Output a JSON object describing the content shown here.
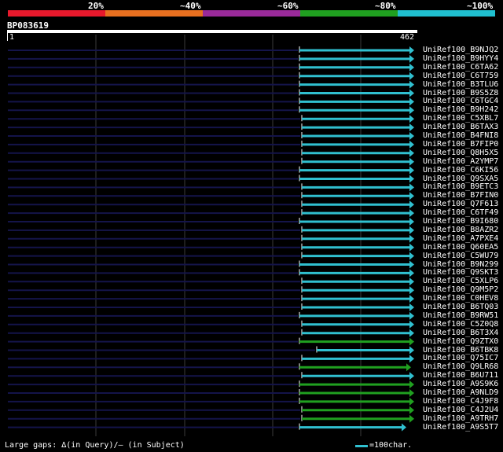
{
  "legend": {
    "segments": [
      {
        "color": "#e8192c"
      },
      {
        "color": "#e87020"
      },
      {
        "color": "#9a2a9a"
      },
      {
        "color": "#20a020"
      },
      {
        "color": "#20c0d0"
      }
    ],
    "labels": [
      "20%",
      "~40%",
      "~60%",
      "~80%",
      "~100%"
    ]
  },
  "query": {
    "id": "BP083619",
    "start": "1",
    "end": "462"
  },
  "colors": {
    "background": "#000000",
    "query_line": "#14144a",
    "grid": "#3a3a3a",
    "hit_cyan": "#30c0d0",
    "hit_green": "#20a020",
    "white": "#ffffff"
  },
  "hits": [
    {
      "label": "UniRef100_B9NJQ2",
      "color": "cyan"
    },
    {
      "label": "UniRef100_B9HYY4",
      "color": "cyan"
    },
    {
      "label": "UniRef100_C6TA62",
      "color": "cyan"
    },
    {
      "label": "UniRef100_C6T759",
      "color": "cyan"
    },
    {
      "label": "UniRef100_B3TLU6",
      "color": "cyan"
    },
    {
      "label": "UniRef100_B9S5Z8",
      "color": "cyan"
    },
    {
      "label": "UniRef100_C6TGC4",
      "color": "cyan"
    },
    {
      "label": "UniRef100_B9H242",
      "color": "cyan"
    },
    {
      "label": "UniRef100_C5XBL7",
      "color": "cyan"
    },
    {
      "label": "UniRef100_B6TAX3",
      "color": "cyan"
    },
    {
      "label": "UniRef100_B4FNI8",
      "color": "cyan"
    },
    {
      "label": "UniRef100_B7FIP0",
      "color": "cyan"
    },
    {
      "label": "UniRef100_Q8H5X5",
      "color": "cyan"
    },
    {
      "label": "UniRef100_A2YMP7",
      "color": "cyan"
    },
    {
      "label": "UniRef100_C6KI56",
      "color": "cyan"
    },
    {
      "label": "UniRef100_Q9SXA5",
      "color": "cyan"
    },
    {
      "label": "UniRef100_B9ETC3",
      "color": "cyan"
    },
    {
      "label": "UniRef100_B7FIN0",
      "color": "cyan"
    },
    {
      "label": "UniRef100_Q7F613",
      "color": "cyan"
    },
    {
      "label": "UniRef100_C6TF49",
      "color": "cyan"
    },
    {
      "label": "UniRef100_B9I680",
      "color": "cyan"
    },
    {
      "label": "UniRef100_B8AZR2",
      "color": "cyan"
    },
    {
      "label": "UniRef100_A7PXE4",
      "color": "cyan"
    },
    {
      "label": "UniRef100_Q60EA5",
      "color": "cyan"
    },
    {
      "label": "UniRef100_C5WU79",
      "color": "cyan"
    },
    {
      "label": "UniRef100_B9N299",
      "color": "cyan"
    },
    {
      "label": "UniRef100_Q9SKT3",
      "color": "cyan"
    },
    {
      "label": "UniRef100_C5XLP6",
      "color": "cyan"
    },
    {
      "label": "UniRef100_Q9M5P2",
      "color": "cyan"
    },
    {
      "label": "UniRef100_C0HEV8",
      "color": "cyan"
    },
    {
      "label": "UniRef100_B6TQ03",
      "color": "cyan"
    },
    {
      "label": "UniRef100_B9RW51",
      "color": "cyan"
    },
    {
      "label": "UniRef100_C5Z0Q8",
      "color": "cyan"
    },
    {
      "label": "UniRef100_B6T3X4",
      "color": "cyan"
    },
    {
      "label": "UniRef100_Q9ZTX0",
      "color": "green"
    },
    {
      "label": "UniRef100_B6TBK8",
      "color": "cyan"
    },
    {
      "label": "UniRef100_Q75IC7",
      "color": "cyan"
    },
    {
      "label": "UniRef100_Q9LR68",
      "color": "green"
    },
    {
      "label": "UniRef100_B6U711",
      "color": "cyan"
    },
    {
      "label": "UniRef100_A9S9K6",
      "color": "green"
    },
    {
      "label": "UniRef100_A9NLD9",
      "color": "green"
    },
    {
      "label": "UniRef100_C4J9F8",
      "color": "green"
    },
    {
      "label": "UniRef100_C4J2U4",
      "color": "green"
    },
    {
      "label": "UniRef100_A9TRH7",
      "color": "green"
    },
    {
      "label": "UniRef100_A9S5T7",
      "color": "cyan"
    }
  ],
  "footer": {
    "gaps_text": "Large gaps: ∆(in Query)/– (in Subject)",
    "scale_text": "=100char."
  }
}
